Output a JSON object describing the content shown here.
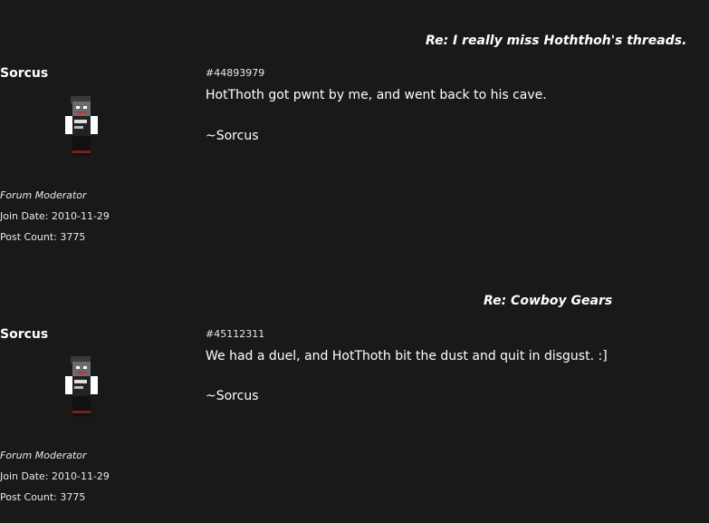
{
  "posts": [
    {
      "title": "Re: I really miss Hoththoh's threads.",
      "author": "Sorcus",
      "role": "Forum Moderator",
      "join_date": "Join Date: 2010-11-29",
      "post_count": "Post Count: 3775",
      "post_id": "#44893979",
      "body": "HotThoth got pwnt by me, and went back to his cave.",
      "signature": "~Sorcus"
    },
    {
      "title": "Re: Cowboy Gears",
      "author": "Sorcus",
      "role": "Forum Moderator",
      "join_date": "Join Date: 2010-11-29",
      "post_count": "Post Count: 3775",
      "post_id": "#45112311",
      "body": "We had a duel, and HotThoth bit the dust and quit in disgust. :]",
      "signature": "~Sorcus"
    }
  ]
}
